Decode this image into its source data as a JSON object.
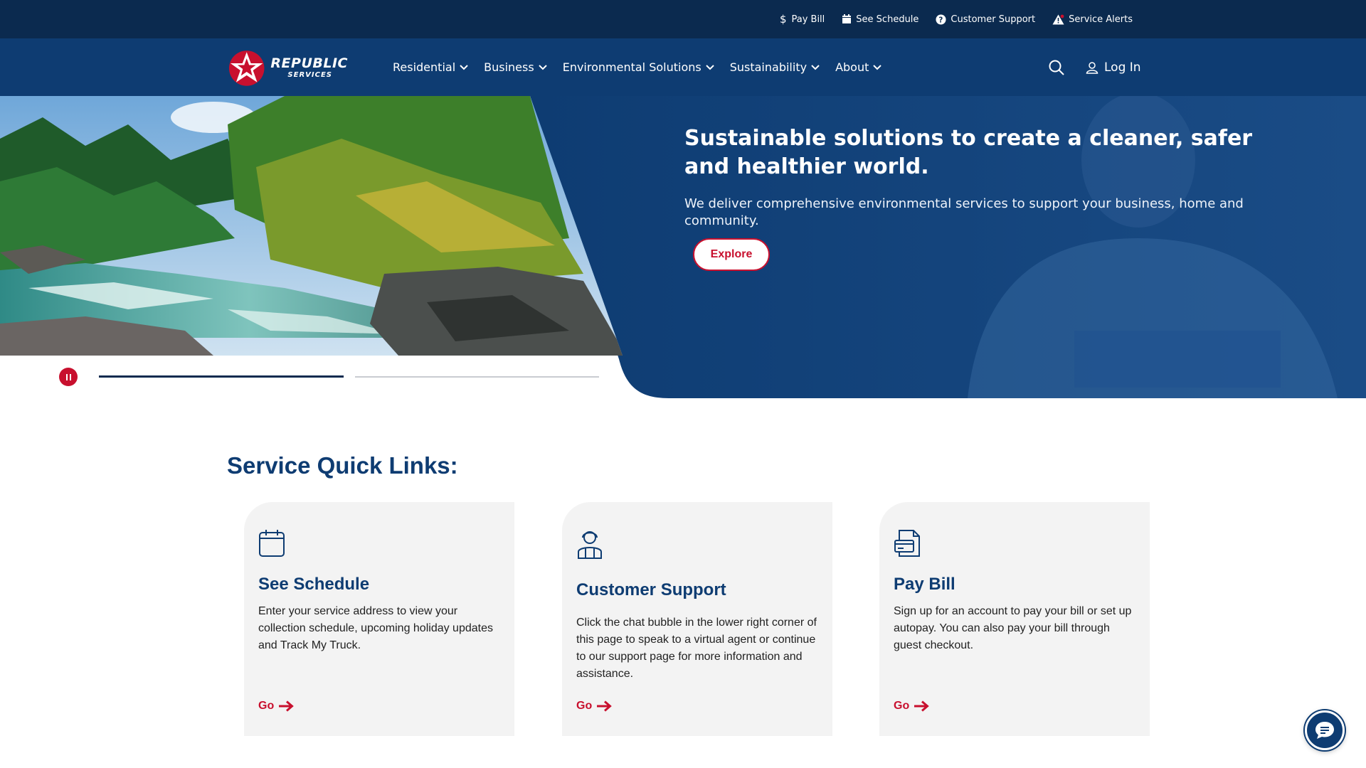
{
  "colors": {
    "utility_bg": "#0b2a4f",
    "nav_bg": "#0e3c72",
    "accent": "#c8102e",
    "card_bg": "#f3f3f3"
  },
  "utility": {
    "links": [
      {
        "label": "Pay Bill",
        "icon": "dollar-icon"
      },
      {
        "label": "See Schedule",
        "icon": "calendar-icon"
      },
      {
        "label": "Customer Support",
        "icon": "question-icon"
      },
      {
        "label": "Service Alerts",
        "icon": "alert-icon"
      }
    ]
  },
  "nav": {
    "logo": {
      "word1": "REPUBLIC",
      "word2": "SERVICES"
    },
    "items": [
      {
        "label": "Residential"
      },
      {
        "label": "Business"
      },
      {
        "label": "Environmental Solutions"
      },
      {
        "label": "Sustainability"
      },
      {
        "label": "About"
      }
    ],
    "login_label": "Log In"
  },
  "hero": {
    "title": "Sustainable solutions to create a cleaner, safer and healthier world.",
    "subtitle": "We deliver comprehensive environmental services to support your business, home and community.",
    "cta_label": "Explore",
    "slides_count": 2,
    "active_slide": 1
  },
  "quick_links": {
    "title": "Service Quick Links:",
    "cards": [
      {
        "title": "See Schedule",
        "text": "Enter your service address to view your collection schedule, upcoming holiday updates and Track My Truck.",
        "go": "Go",
        "icon": "calendar-icon"
      },
      {
        "title": "Customer Support",
        "text": "Click the chat bubble in the lower right corner of this page to speak to a virtual agent or continue to our support page for more information and assistance.",
        "go": "Go",
        "icon": "support-agent-icon"
      },
      {
        "title": "Pay Bill",
        "text": "Sign up for an account to pay your bill or set up autopay. You can also pay your bill through guest checkout.",
        "go": "Go",
        "icon": "bill-icon"
      }
    ]
  }
}
